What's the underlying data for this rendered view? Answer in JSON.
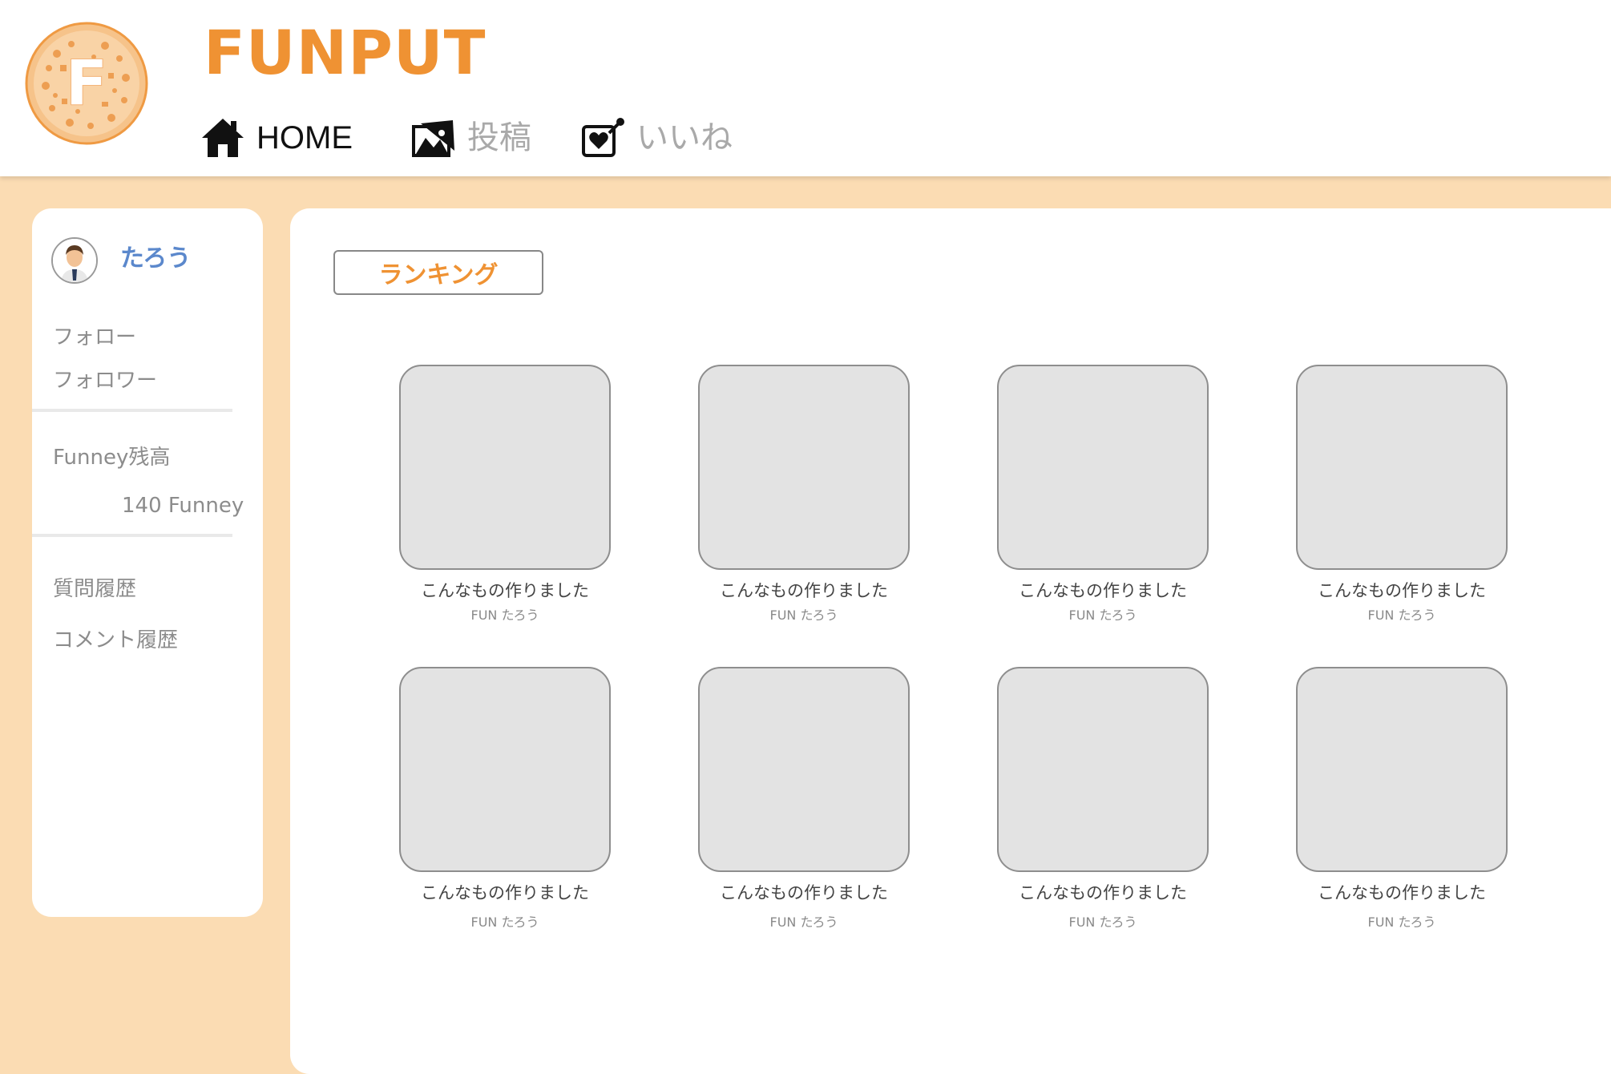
{
  "brand": {
    "name": "FUNPUT",
    "logo_letter": "F"
  },
  "nav": {
    "items": [
      {
        "label": "HOME",
        "icon": "home-icon",
        "active": true
      },
      {
        "label": "投稿",
        "icon": "post-photo-icon",
        "active": false
      },
      {
        "label": "いいね",
        "icon": "like-heart-icon",
        "active": false
      }
    ]
  },
  "sidebar": {
    "username": "たろう",
    "follow_label": "フォロー",
    "follower_label": "フォロワー",
    "balance_label": "Funney残高",
    "balance_value": "140 Funney",
    "question_history_label": "質問履歴",
    "comment_history_label": "コメント履歴"
  },
  "main": {
    "ranking_label": "ランキング",
    "cards": [
      {
        "title": "こんなもの作りました",
        "author": "FUN たろう"
      },
      {
        "title": "こんなもの作りました",
        "author": "FUN たろう"
      },
      {
        "title": "こんなもの作りました",
        "author": "FUN たろう"
      },
      {
        "title": "こんなもの作りました",
        "author": "FUN たろう"
      },
      {
        "title": "こんなもの作りました",
        "author": "FUN たろう"
      },
      {
        "title": "こんなもの作りました",
        "author": "FUN たろう"
      },
      {
        "title": "こんなもの作りました",
        "author": "FUN たろう"
      },
      {
        "title": "こんなもの作りました",
        "author": "FUN たろう"
      }
    ]
  },
  "colors": {
    "accent": "#ef9233",
    "page_background": "#fbdcb3",
    "username": "#5b88cc",
    "inactive_nav": "#a9a9a9",
    "thumb_fill": "#e3e3e3"
  }
}
